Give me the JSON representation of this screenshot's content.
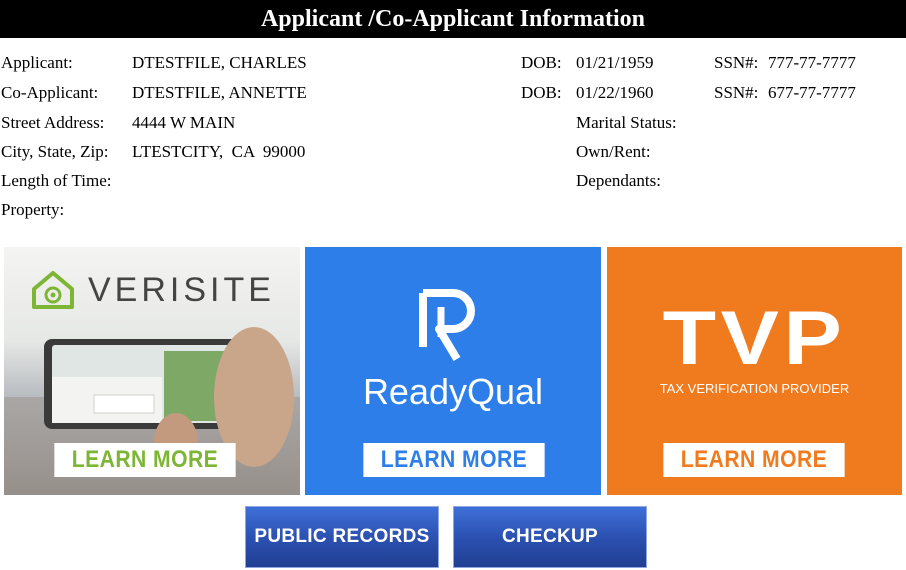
{
  "header": {
    "title": "Applicant /Co-Applicant Information"
  },
  "applicant": {
    "label": "Applicant:",
    "name": "DTESTFILE, CHARLES",
    "dob_label": "DOB:",
    "dob": "01/21/1959",
    "ssn_label": "SSN#:",
    "ssn": "777-77-7777"
  },
  "co_applicant": {
    "label": "Co-Applicant:",
    "name": "DTESTFILE, ANNETTE",
    "dob_label": "DOB:",
    "dob": "01/22/1960",
    "ssn_label": "SSN#:",
    "ssn": "677-77-7777"
  },
  "address": {
    "street_label": "Street Address:",
    "street": "4444 W MAIN",
    "csz_label": "City, State, Zip:",
    "csz": "LTESTCITY,  CA  99000",
    "length_label": "Length of Time:",
    "property_label": "Property:"
  },
  "details": {
    "marital_label": "Marital Status:",
    "own_rent_label": "Own/Rent:",
    "dependants_label": "Dependants:"
  },
  "cards": {
    "verisite": {
      "logo_text": "VERISITE",
      "button_label": "LEARN MORE",
      "button_color": "#7db535"
    },
    "readyqual": {
      "logo_text": "ReadyQual",
      "button_label": "LEARN MORE",
      "button_color": "#2d7ee8"
    },
    "tvp": {
      "logo_text": "TVP",
      "tagline": "TAX VERIFICATION PROVIDER",
      "button_label": "LEARN MORE",
      "button_color": "#f07a1e"
    }
  },
  "actions": {
    "public_records_label": "PUBLIC RECORDS",
    "checkup_label": "CHECKUP"
  },
  "colors": {
    "header_bg": "#000000",
    "action_blue": "#2a4fae"
  }
}
